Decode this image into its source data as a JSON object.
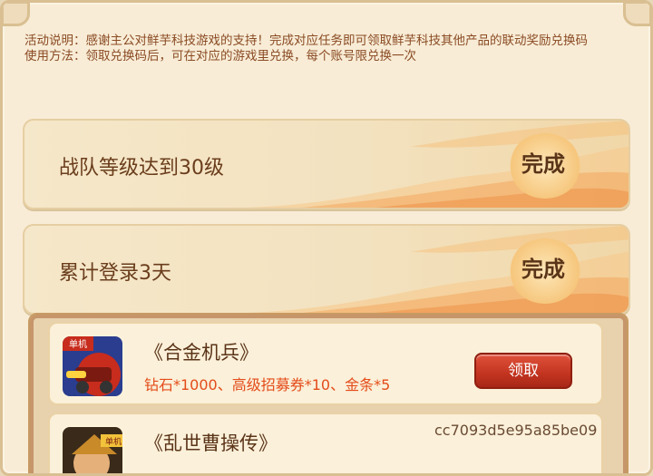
{
  "description": {
    "line1": "活动说明：感谢主公对鲜芋科技游戏的支持！完成对应任务即可领取鲜芋科技其他产品的联动奖励兑换码",
    "line2": "使用方法：领取兑换码后，可在对应的游戏里兑换，每个账号限兑换一次"
  },
  "tasks": [
    {
      "label": "战队等级达到30级",
      "status": "完成"
    },
    {
      "label": "累计登录3天",
      "status": "完成"
    }
  ],
  "rewards": [
    {
      "icon": "game-icon-mecha-tank",
      "badge": "单机",
      "title": "《合金机兵》",
      "items": "钻石*1000、高级招募券*10、金条*5",
      "button": "领取"
    },
    {
      "icon": "game-icon-warrior",
      "badge": "单机",
      "title": "《乱世曹操传》",
      "code": "cc7093d5e95a85be09"
    }
  ],
  "colors": {
    "accent_red": "#c2341f",
    "reward_text": "#e44c1a",
    "desc_text": "#8a4b24"
  }
}
